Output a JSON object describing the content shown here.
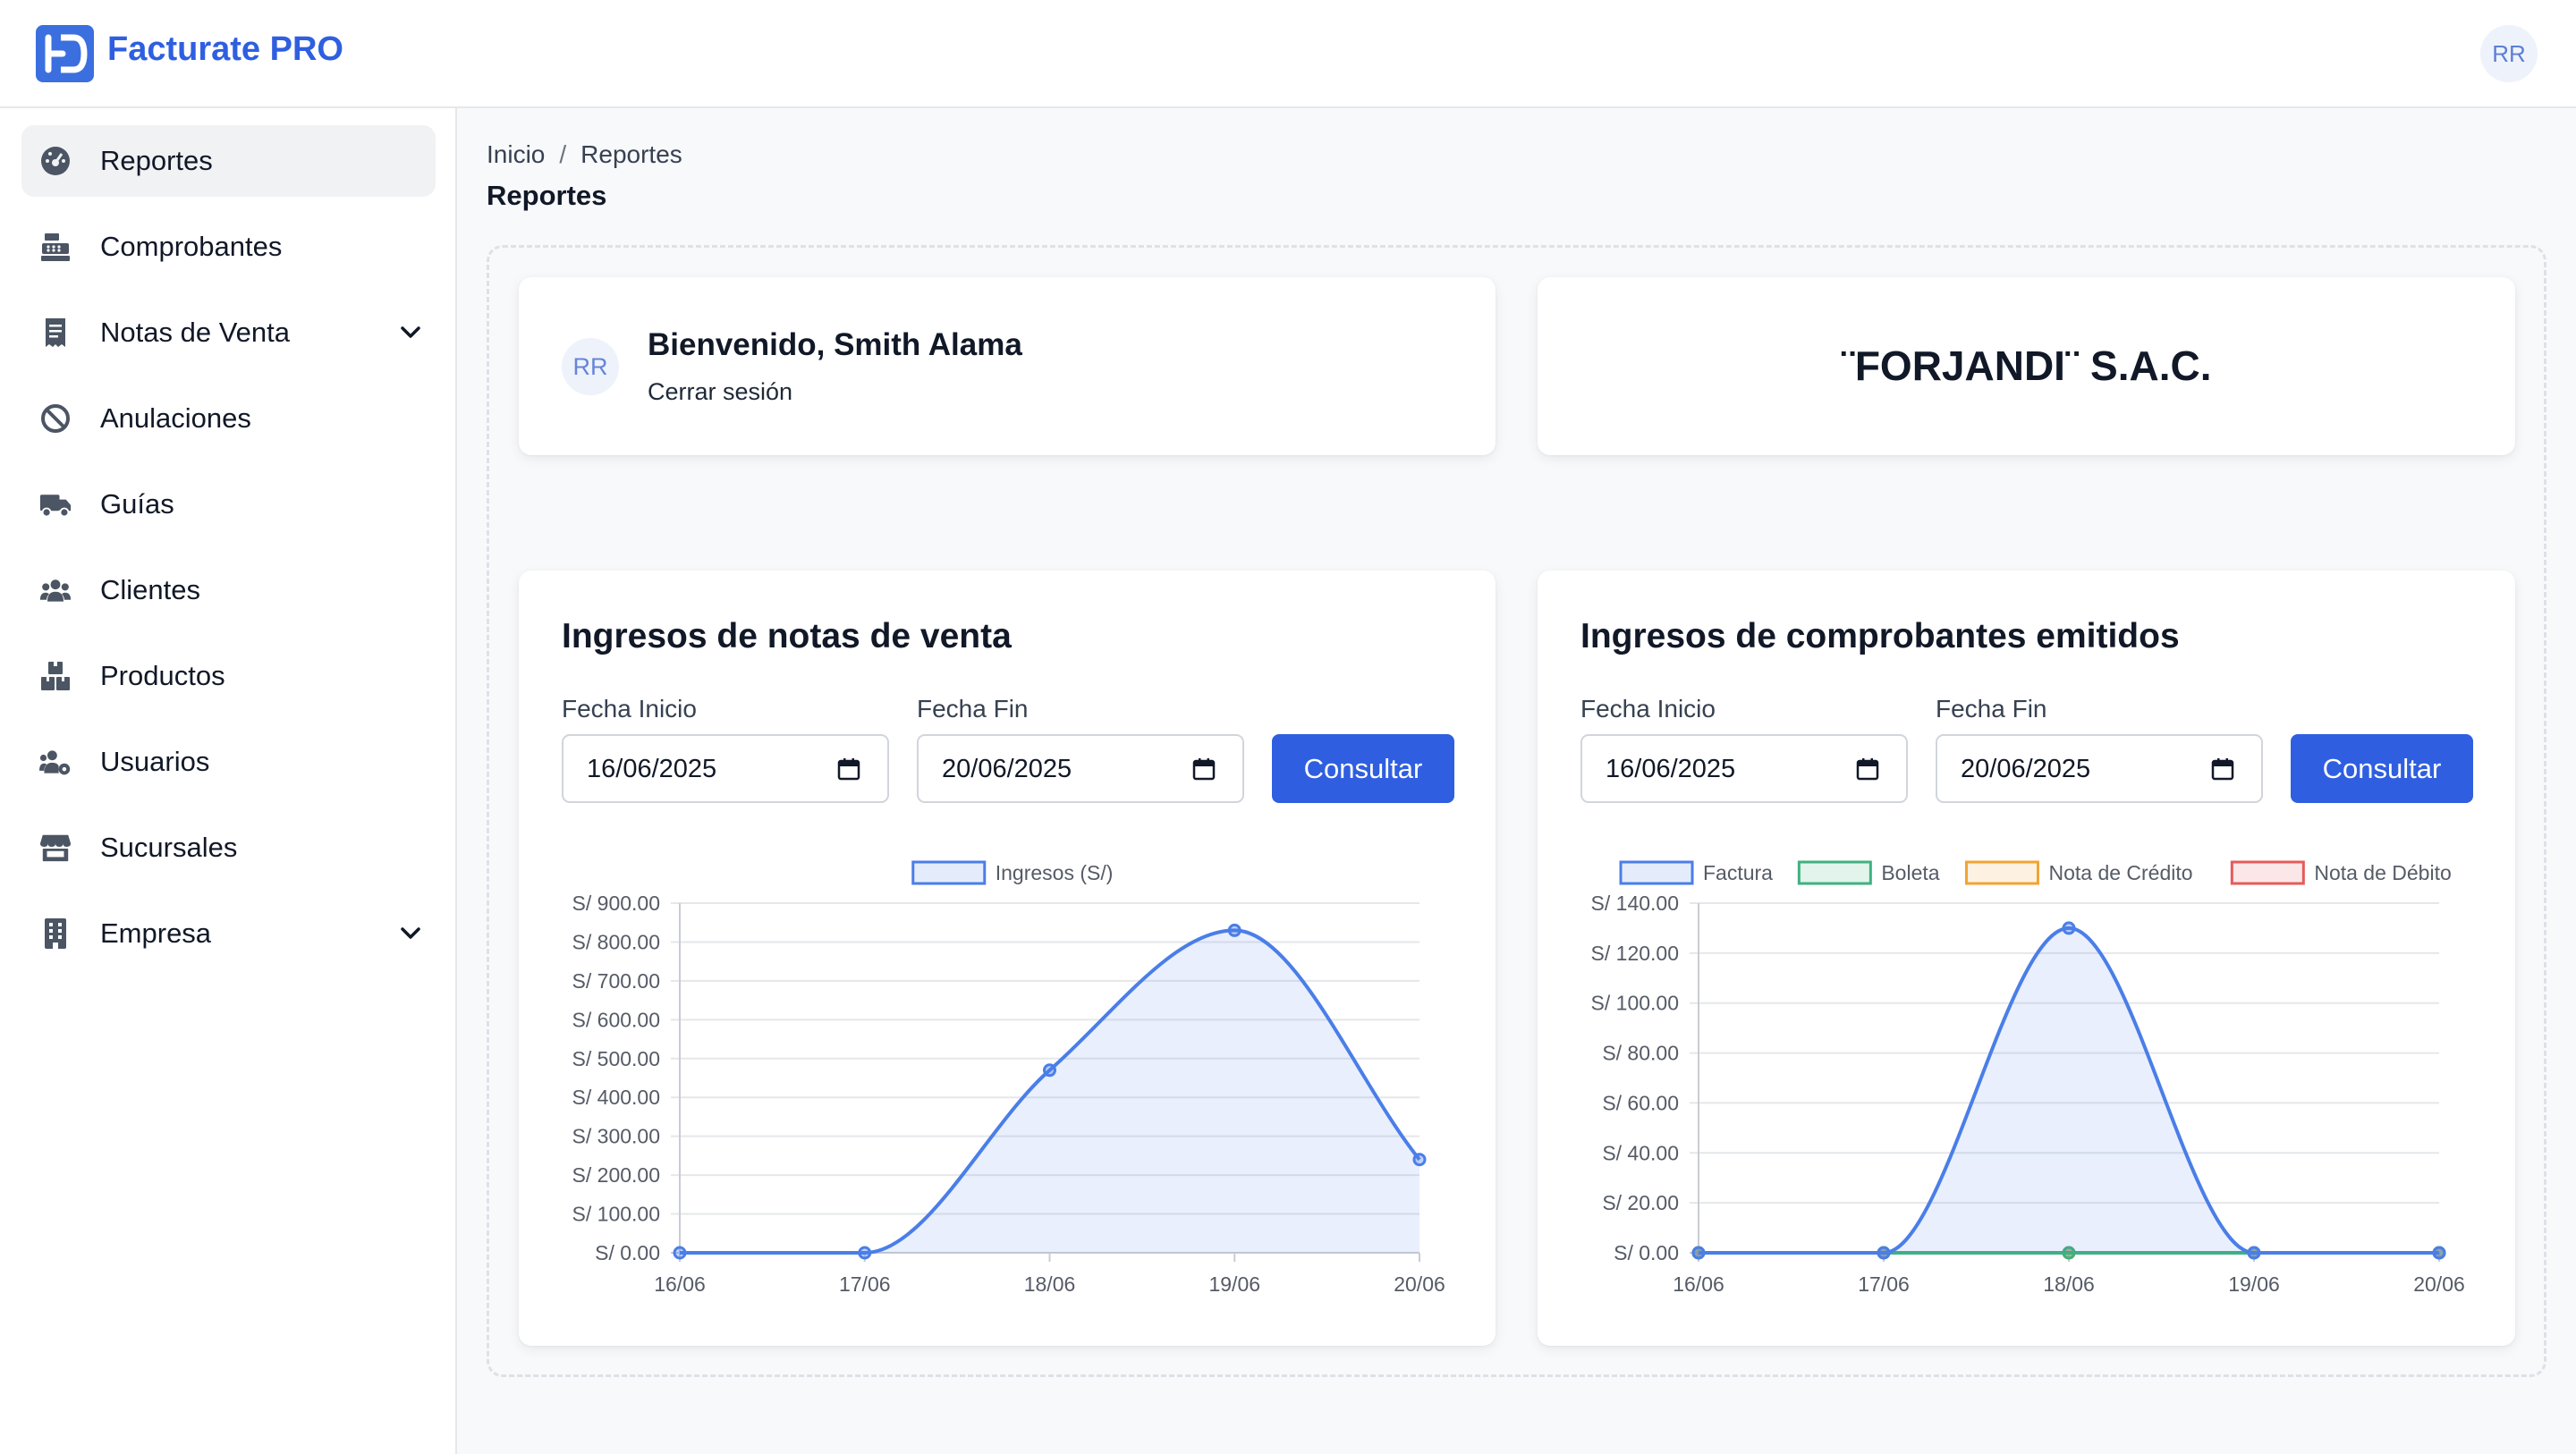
{
  "app": {
    "brand": "Facturate PRO",
    "user_initials": "RR"
  },
  "sidebar": {
    "items": [
      {
        "label": "Reportes",
        "icon": "dashboard-gauge-icon",
        "active": true
      },
      {
        "label": "Comprobantes",
        "icon": "cash-register-icon"
      },
      {
        "label": "Notas de Venta",
        "icon": "receipt-icon",
        "has_submenu": true
      },
      {
        "label": "Anulaciones",
        "icon": "ban-icon"
      },
      {
        "label": "Guías",
        "icon": "truck-icon"
      },
      {
        "label": "Clientes",
        "icon": "users-icon"
      },
      {
        "label": "Productos",
        "icon": "boxes-icon"
      },
      {
        "label": "Usuarios",
        "icon": "users-gear-icon"
      },
      {
        "label": "Sucursales",
        "icon": "store-icon"
      },
      {
        "label": "Empresa",
        "icon": "building-icon",
        "has_submenu": true
      }
    ]
  },
  "breadcrumb": {
    "home": "Inicio",
    "separator": "/",
    "current": "Reportes"
  },
  "page": {
    "title": "Reportes"
  },
  "welcome": {
    "avatar": "RR",
    "title": "Bienvenido, Smith Alama",
    "logout": "Cerrar sesión"
  },
  "company": {
    "name": "¨FORJANDI¨ S.A.C."
  },
  "sales_panel": {
    "title": "Ingresos de notas de venta",
    "start_label": "Fecha Inicio",
    "end_label": "Fecha Fin",
    "start_value": "16/06/2025",
    "end_value": "20/06/2025",
    "button": "Consultar"
  },
  "vouchers_panel": {
    "title": "Ingresos de comprobantes emitidos",
    "start_label": "Fecha Inicio",
    "end_label": "Fecha Fin",
    "start_value": "16/06/2025",
    "end_value": "20/06/2025",
    "button": "Consultar"
  },
  "colors": {
    "accent": "#2f5fe0",
    "factura": "#4a7ee8",
    "boleta": "#3fb27f",
    "nota_credito": "#f0a433",
    "nota_debito": "#e55b5b"
  },
  "chart_data": [
    {
      "type": "area",
      "categories": [
        "16/06",
        "17/06",
        "18/06",
        "19/06",
        "20/06"
      ],
      "series": [
        {
          "name": "Ingresos (S/)",
          "values": [
            0,
            0,
            470,
            830,
            240
          ],
          "color": "#4a7ee8"
        }
      ],
      "ylim": [
        0,
        900
      ],
      "yticks": [
        "S/ 0.00",
        "S/ 100.00",
        "S/ 200.00",
        "S/ 300.00",
        "S/ 400.00",
        "S/ 500.00",
        "S/ 600.00",
        "S/ 700.00",
        "S/ 800.00",
        "S/ 900.00"
      ],
      "grid": true,
      "legend": "top"
    },
    {
      "type": "area",
      "categories": [
        "16/06",
        "17/06",
        "18/06",
        "19/06",
        "20/06"
      ],
      "series": [
        {
          "name": "Factura",
          "values": [
            0,
            0,
            130,
            0,
            0
          ],
          "color": "#4a7ee8"
        },
        {
          "name": "Boleta",
          "values": [
            0,
            0,
            0,
            0,
            0
          ],
          "color": "#3fb27f"
        },
        {
          "name": "Nota de Crédito",
          "values": [
            0,
            0,
            0,
            0,
            0
          ],
          "color": "#f0a433"
        },
        {
          "name": "Nota de Débito",
          "values": [
            0,
            0,
            0,
            0,
            0
          ],
          "color": "#e55b5b"
        }
      ],
      "ylim": [
        0,
        140
      ],
      "yticks": [
        "S/ 0.00",
        "S/ 20.00",
        "S/ 40.00",
        "S/ 60.00",
        "S/ 80.00",
        "S/ 100.00",
        "S/ 120.00",
        "S/ 140.00"
      ],
      "grid": true,
      "legend": "top"
    }
  ]
}
